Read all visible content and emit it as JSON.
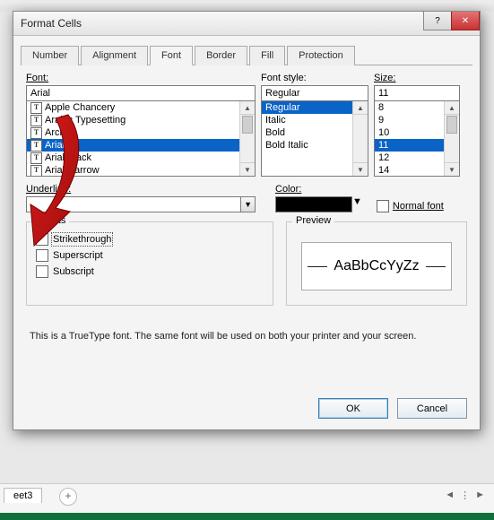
{
  "dialog": {
    "title": "Format Cells",
    "tabs": [
      "Number",
      "Alignment",
      "Font",
      "Border",
      "Fill",
      "Protection"
    ],
    "selected_tab": "Font"
  },
  "font": {
    "label": "Font:",
    "value": "Arial",
    "items": [
      "Apple Chancery",
      "Arabic Typesetting",
      "Archie",
      "Arial",
      "Arial Black",
      "Arial Narrow"
    ],
    "selected_index": 3
  },
  "style": {
    "label": "Font style:",
    "value": "Regular",
    "items": [
      "Regular",
      "Italic",
      "Bold",
      "Bold Italic"
    ],
    "selected_index": 0
  },
  "size": {
    "label": "Size:",
    "value": "11",
    "items": [
      "8",
      "9",
      "10",
      "11",
      "12",
      "14"
    ],
    "selected_index": 3
  },
  "underline": {
    "label": "Underline:",
    "value": ""
  },
  "color": {
    "label": "Color:",
    "value": "#000000"
  },
  "normal_font": {
    "label": "Normal font",
    "checked": false
  },
  "effects": {
    "label": "Effects",
    "items": [
      {
        "label": "Strikethrough",
        "checked": false,
        "focused": true
      },
      {
        "label": "Superscript",
        "checked": false,
        "focused": false
      },
      {
        "label": "Subscript",
        "checked": false,
        "focused": false
      }
    ]
  },
  "preview": {
    "label": "Preview",
    "text": "AaBbCcYyZz"
  },
  "hint": "This is a TrueType font.  The same font will be used on both your printer and your screen.",
  "buttons": {
    "ok": "OK",
    "cancel": "Cancel"
  },
  "sheet": {
    "tab": "eet3",
    "plus": "+"
  }
}
